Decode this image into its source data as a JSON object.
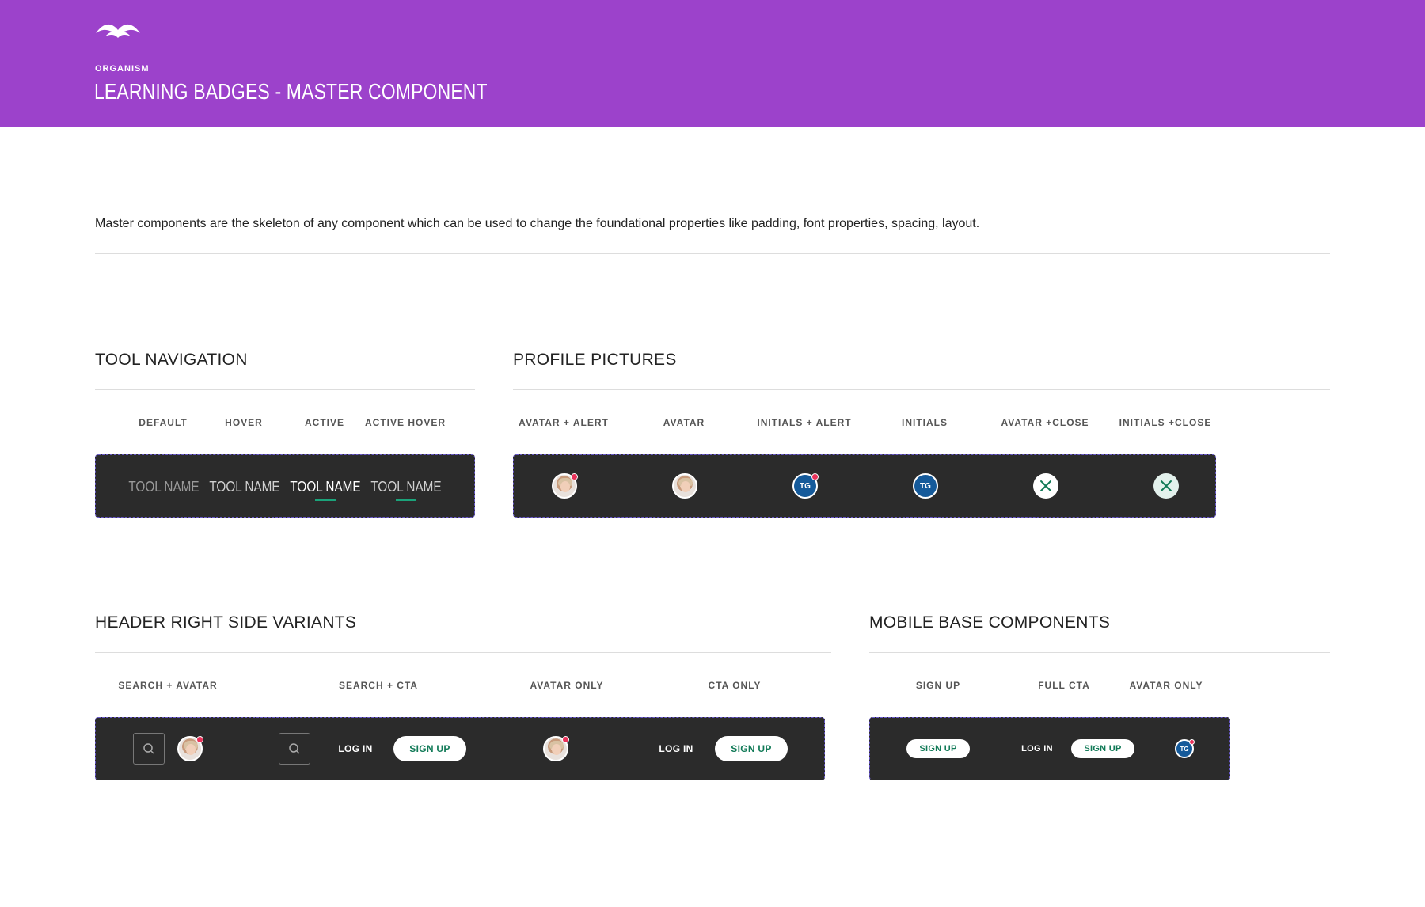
{
  "header": {
    "eyebrow": "ORGANISM",
    "title": "LEARNING BADGES - MASTER COMPONENT",
    "background": "#9c42cb",
    "logo_icon": "wave-arc-logo"
  },
  "intro": "Master components are the skeleton of any component which can be used to change the foundational properties like padding, font properties, spacing, layout.",
  "tool_navigation": {
    "title": "TOOL NAVIGATION",
    "columns": [
      "DEFAULT",
      "HOVER",
      "ACTIVE",
      "ACTIVE HOVER"
    ],
    "items": [
      {
        "label": "TOOL NAME",
        "state": "default",
        "color": "#9a9a9a"
      },
      {
        "label": "TOOL NAME",
        "state": "hover",
        "color": "#d0d0d0"
      },
      {
        "label": "TOOL NAME",
        "state": "active",
        "color": "#ffffff"
      },
      {
        "label": "TOOL NAME",
        "state": "active-hover",
        "color": "#d0d0d0"
      }
    ],
    "underline_color": "#1ba37a"
  },
  "profile_pictures": {
    "title": "PROFILE PICTURES",
    "columns": [
      "AVATAR + ALERT",
      "AVATAR",
      "INITIALS + ALERT",
      "INITIALS",
      "AVATAR +CLOSE",
      "INITIALS +CLOSE"
    ],
    "initials": "TG",
    "alert_color": "#e8325a",
    "initials_bg": "#155a9a"
  },
  "header_right": {
    "title": "HEADER RIGHT SIDE VARIANTS",
    "columns": [
      "SEARCH + AVATAR",
      "SEARCH + CTA",
      "AVATAR ONLY",
      "CTA ONLY"
    ],
    "login_label": "LOG IN",
    "signup_label": "SIGN UP"
  },
  "mobile_base": {
    "title": "MOBILE BASE COMPONENTS",
    "columns": [
      "SIGN UP",
      "FULL CTA",
      "AVATAR ONLY"
    ],
    "login_label": "LOG IN",
    "signup_label": "SIGN UP",
    "initials": "TG"
  }
}
